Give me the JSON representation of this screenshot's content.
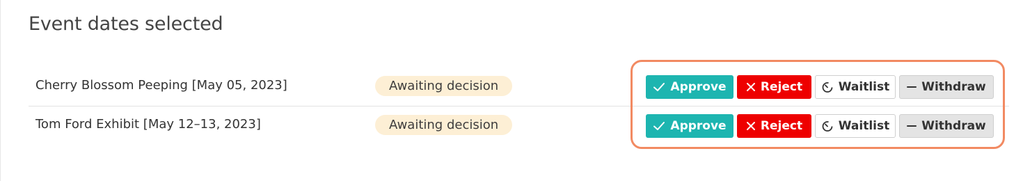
{
  "page": {
    "title": "Event dates selected"
  },
  "events": [
    {
      "name": "Cherry Blossom Peeping [May 05, 2023]",
      "status": "Awaiting decision",
      "actions": {
        "approve": "Approve",
        "reject": "Reject",
        "waitlist": "Waitlist",
        "withdraw": "Withdraw"
      }
    },
    {
      "name": "Tom Ford Exhibit [May 12–13, 2023]",
      "status": "Awaiting decision",
      "actions": {
        "approve": "Approve",
        "reject": "Reject",
        "waitlist": "Waitlist",
        "withdraw": "Withdraw"
      }
    }
  ],
  "colors": {
    "approve": "#1db5b0",
    "reject": "#ee0000",
    "badge": "#fdefd5",
    "highlight": "#f28a62"
  },
  "icons": {
    "approve": "check-icon",
    "reject": "x-icon",
    "waitlist": "timer-icon",
    "withdraw": "minus-icon"
  }
}
